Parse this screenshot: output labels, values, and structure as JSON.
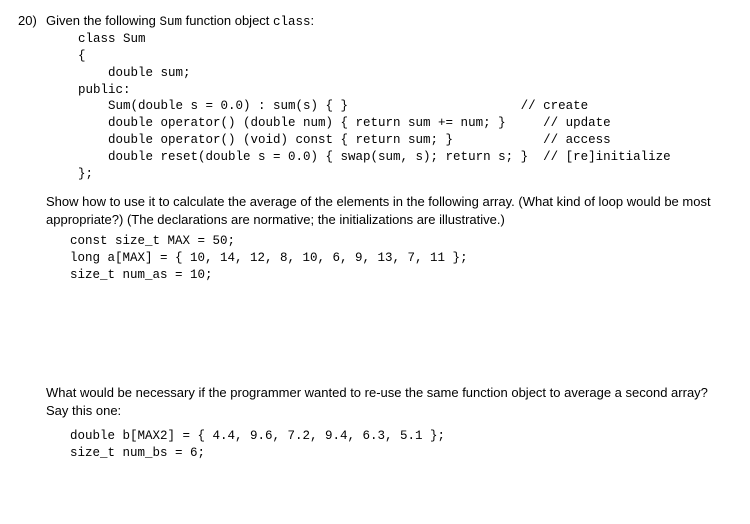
{
  "question_number": "20)",
  "intro_text_a": "Given the following ",
  "intro_code_a": "Sum",
  "intro_text_b": " function object ",
  "intro_code_b": "class",
  "intro_text_c": ":",
  "class_code": "class Sum\n{\n    double sum;\npublic:\n    Sum(double s = 0.0) : sum(s) { }                       // create\n    double operator() (double num) { return sum += num; }     // update\n    double operator() (void) const { return sum; }            // access\n    double reset(double s = 0.0) { swap(sum, s); return s; }  // [re]initialize\n};",
  "prompt1": "Show how to use it to calculate the average of the elements in the following array. (What kind of loop would be most appropriate?) (The declarations are normative; the initializations are illustrative.)",
  "decl_code": "const size_t MAX = 50;\nlong a[MAX] = { 10, 14, 12, 8, 10, 6, 9, 13, 7, 11 };\nsize_t num_as = 10;",
  "prompt2": "What would be necessary if the programmer wanted to re-use the same function object to average a second array? Say this one:",
  "decl_code2": "double b[MAX2] = { 4.4, 9.6, 7.2, 9.4, 6.3, 5.1 };\nsize_t num_bs = 6;"
}
